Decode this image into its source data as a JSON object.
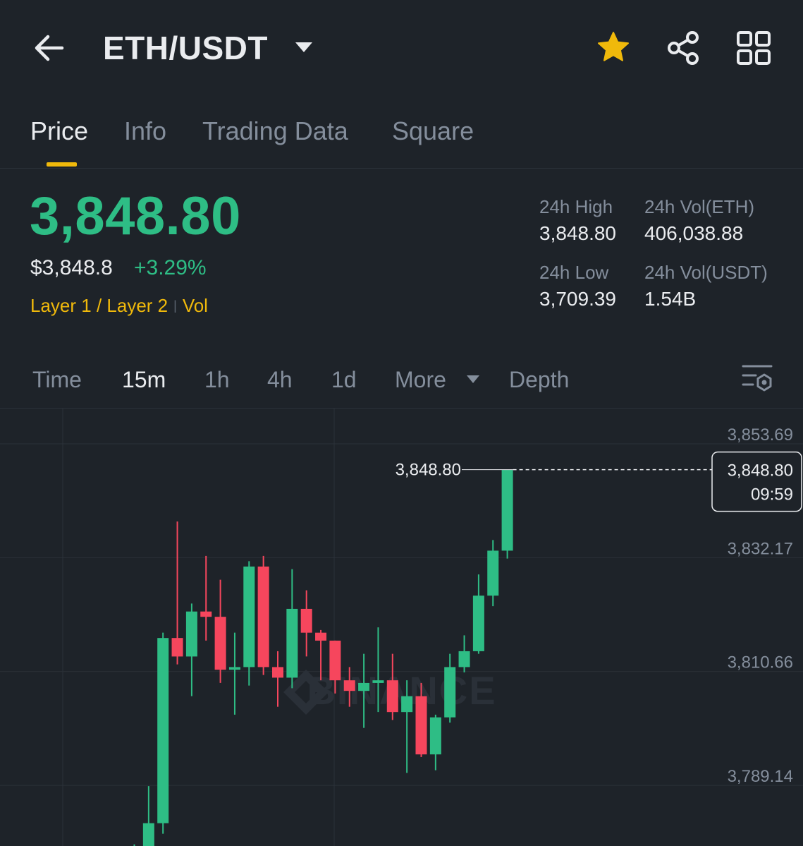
{
  "header": {
    "pair": "ETH/USDT",
    "back_icon": "arrow-left-icon",
    "caret_icon": "caret-down-icon",
    "favorite_icon": "star-icon",
    "share_icon": "share-icon",
    "grid_icon": "grid-icon",
    "favorite_color": "#f0b90b"
  },
  "tabs": [
    {
      "label": "Price",
      "active": true
    },
    {
      "label": "Info",
      "active": false
    },
    {
      "label": "Trading Data",
      "active": false
    },
    {
      "label": "Square",
      "active": false
    }
  ],
  "ticker": {
    "last_price": "3,848.80",
    "usd_price": "$3,848.8",
    "change_pct": "+3.29%",
    "tag_category": "Layer 1 / Layer 2",
    "tag_vol": "Vol",
    "high_label": "24h High",
    "high_value": "3,848.80",
    "vol_eth_label": "24h Vol(ETH)",
    "vol_eth_value": "406,038.88",
    "low_label": "24h Low",
    "low_value": "3,709.39",
    "vol_usdt_label": "24h Vol(USDT)",
    "vol_usdt_value": "1.54B"
  },
  "timeframes": {
    "time": "Time",
    "m15": "15m",
    "h1": "1h",
    "h4": "4h",
    "d1": "1d",
    "more": "More",
    "depth": "Depth",
    "active": "15m",
    "settings_icon": "chart-settings-icon"
  },
  "colors": {
    "up": "#2ebd85",
    "down": "#f6465d",
    "accent": "#f0b90b",
    "background": "#1e2329"
  },
  "chart_data": {
    "type": "candlestick",
    "y_axis_labels": [
      "3,853.69",
      "3,832.17",
      "3,810.66",
      "3,789.14"
    ],
    "y_axis_values": [
      3853.69,
      3832.17,
      3810.66,
      3789.14
    ],
    "y_range": [
      3772.0,
      3857.5
    ],
    "last_price_label": "3,848.80",
    "current_price_box": {
      "price": "3,848.80",
      "countdown": "09:59"
    },
    "watermark": "BINANCE",
    "candles": [
      {
        "o": 3773.5,
        "h": 3778.0,
        "l": 3772.0,
        "c": 3775.0
      },
      {
        "o": 3775.0,
        "h": 3789.0,
        "l": 3772.5,
        "c": 3782.0
      },
      {
        "o": 3782.0,
        "h": 3818.0,
        "l": 3780.0,
        "c": 3817.0
      },
      {
        "o": 3817.0,
        "h": 3839.0,
        "l": 3812.0,
        "c": 3813.5
      },
      {
        "o": 3813.5,
        "h": 3823.5,
        "l": 3806.0,
        "c": 3822.0
      },
      {
        "o": 3822.0,
        "h": 3832.5,
        "l": 3816.5,
        "c": 3821.0
      },
      {
        "o": 3821.0,
        "h": 3828.0,
        "l": 3808.5,
        "c": 3811.0
      },
      {
        "o": 3811.0,
        "h": 3818.0,
        "l": 3802.5,
        "c": 3811.5
      },
      {
        "o": 3811.5,
        "h": 3831.5,
        "l": 3808.0,
        "c": 3830.5
      },
      {
        "o": 3830.5,
        "h": 3832.5,
        "l": 3810.0,
        "c": 3811.5
      },
      {
        "o": 3811.5,
        "h": 3814.5,
        "l": 3804.0,
        "c": 3809.5
      },
      {
        "o": 3809.5,
        "h": 3830.0,
        "l": 3807.5,
        "c": 3822.5
      },
      {
        "o": 3822.5,
        "h": 3826.0,
        "l": 3813.5,
        "c": 3818.0
      },
      {
        "o": 3818.0,
        "h": 3818.5,
        "l": 3809.0,
        "c": 3816.5
      },
      {
        "o": 3816.5,
        "h": 3816.5,
        "l": 3806.5,
        "c": 3809.0
      },
      {
        "o": 3809.0,
        "h": 3811.5,
        "l": 3804.0,
        "c": 3807.0
      },
      {
        "o": 3807.0,
        "h": 3814.0,
        "l": 3800.0,
        "c": 3808.5
      },
      {
        "o": 3808.5,
        "h": 3819.0,
        "l": 3803.0,
        "c": 3809.0
      },
      {
        "o": 3809.0,
        "h": 3814.0,
        "l": 3801.5,
        "c": 3803.0
      },
      {
        "o": 3803.0,
        "h": 3809.0,
        "l": 3791.5,
        "c": 3806.0
      },
      {
        "o": 3806.0,
        "h": 3808.5,
        "l": 3794.5,
        "c": 3795.0
      },
      {
        "o": 3795.0,
        "h": 3802.5,
        "l": 3792.0,
        "c": 3802.0
      },
      {
        "o": 3802.0,
        "h": 3814.0,
        "l": 3801.0,
        "c": 3811.5
      },
      {
        "o": 3811.5,
        "h": 3817.5,
        "l": 3810.5,
        "c": 3814.5
      },
      {
        "o": 3814.5,
        "h": 3829.0,
        "l": 3814.0,
        "c": 3825.0
      },
      {
        "o": 3825.0,
        "h": 3835.5,
        "l": 3823.0,
        "c": 3833.5
      },
      {
        "o": 3833.5,
        "h": 3848.8,
        "l": 3832.0,
        "c": 3848.8
      }
    ]
  }
}
